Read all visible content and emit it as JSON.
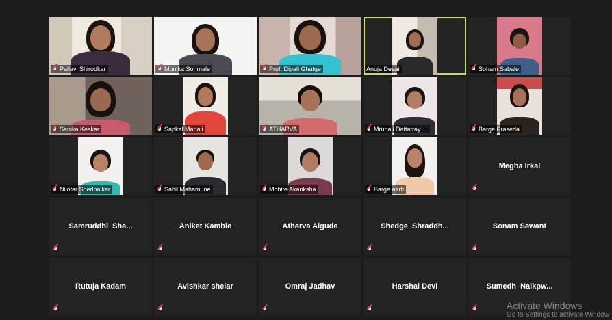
{
  "participants": [
    {
      "name": "Pallavi Shirodkar"
    },
    {
      "name": "Monika Sonmale"
    },
    {
      "name": "Prof. Dipali Ghatge"
    },
    {
      "name": "Anuja Desai"
    },
    {
      "name": "Soham Sabale"
    },
    {
      "name": "Sanika Keskar"
    },
    {
      "name": "Sapkal Manali"
    },
    {
      "name": "ATHARVA"
    },
    {
      "name": "Mrunali Dattatray ..."
    },
    {
      "name": "Barge Praseda"
    },
    {
      "name": "Nilofar Shedbalkar"
    },
    {
      "name": "Sahil Mahamune"
    },
    {
      "name": "Mohite Akanksha"
    },
    {
      "name": "Barge aarti"
    },
    {
      "name": "Megha Irkal"
    },
    {
      "name": "Samruddhi  Sha..."
    },
    {
      "name": "Aniket Kamble"
    },
    {
      "name": "Atharva Algude"
    },
    {
      "name": "Shedge  Shraddh..."
    },
    {
      "name": "Sonam Sawant"
    },
    {
      "name": "Rutuja Kadam"
    },
    {
      "name": "Avishkar shelar"
    },
    {
      "name": "Omraj Jadhav"
    },
    {
      "name": "Harshal Devi"
    },
    {
      "name": "Sumedh  Naikpw..."
    }
  ],
  "active_speaker_border_color": "#c8e04a",
  "muted_icon": "mic-muted-icon",
  "watermark": {
    "title": "Activate Windows",
    "subtitle": "Go to Settings to activate Window"
  }
}
